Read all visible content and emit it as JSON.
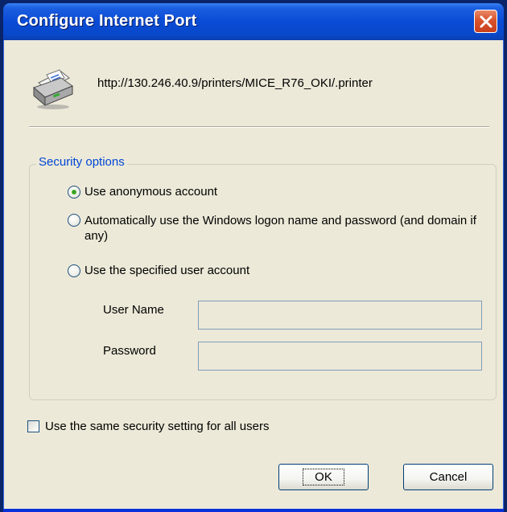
{
  "window": {
    "title": "Configure Internet Port",
    "close_icon": "close-icon"
  },
  "printer": {
    "icon": "printer-icon",
    "url": "http://130.246.40.9/printers/MICE_R76_OKI/.printer"
  },
  "security": {
    "legend": "Security options",
    "options": [
      {
        "label": "Use anonymous account",
        "checked": true
      },
      {
        "label": "Automatically use the Windows logon name and password (and domain if any)",
        "checked": false
      },
      {
        "label": "Use the specified user account",
        "checked": false
      }
    ],
    "user_name_label": "User Name",
    "user_name_value": "",
    "password_label": "Password",
    "password_value": ""
  },
  "same_setting": {
    "label": "Use the same security setting for all users",
    "checked": false
  },
  "buttons": {
    "ok": "OK",
    "cancel": "Cancel"
  },
  "colors": {
    "title_bar": "#0a4bd6",
    "close_button": "#d9532c",
    "dialog_face": "#ece9d8",
    "group_legend": "#0046d5"
  }
}
